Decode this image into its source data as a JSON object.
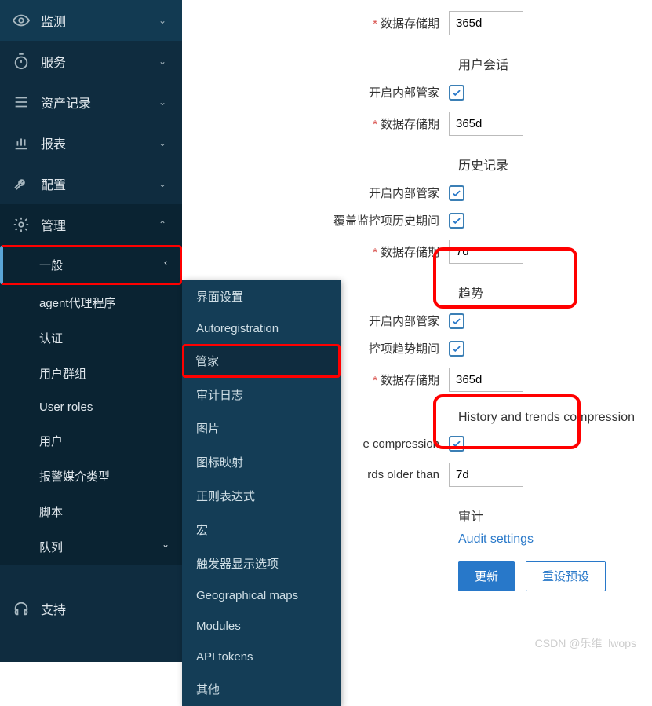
{
  "sidebar": {
    "main": [
      {
        "label": "监测",
        "icon": "eye"
      },
      {
        "label": "服务",
        "icon": "timer"
      },
      {
        "label": "资产记录",
        "icon": "list"
      },
      {
        "label": "报表",
        "icon": "chart"
      },
      {
        "label": "配置",
        "icon": "wrench"
      },
      {
        "label": "管理",
        "icon": "gear"
      }
    ],
    "sub": [
      {
        "label": "一般",
        "active": true
      },
      {
        "label": "agent代理程序"
      },
      {
        "label": "认证"
      },
      {
        "label": "用户群组"
      },
      {
        "label": "User roles"
      },
      {
        "label": "用户"
      },
      {
        "label": "报警媒介类型"
      },
      {
        "label": "脚本"
      },
      {
        "label": "队列"
      }
    ],
    "support": {
      "label": "支持",
      "icon": "headset"
    }
  },
  "submenu": [
    {
      "label": "界面设置"
    },
    {
      "label": "Autoregistration"
    },
    {
      "label": "管家",
      "active": true
    },
    {
      "label": "审计日志"
    },
    {
      "label": "图片"
    },
    {
      "label": "图标映射"
    },
    {
      "label": "正则表达式"
    },
    {
      "label": "宏"
    },
    {
      "label": "触发器显示选项"
    },
    {
      "label": "Geographical maps"
    },
    {
      "label": "Modules"
    },
    {
      "label": "API tokens"
    },
    {
      "label": "其他"
    }
  ],
  "form": {
    "top_storage": {
      "label": "数据存储期",
      "value": "365d"
    },
    "session": {
      "heading": "用户会话",
      "enable_label": "开启内部管家",
      "storage_label": "数据存储期",
      "storage_value": "365d"
    },
    "history": {
      "heading": "历史记录",
      "enable_label": "开启内部管家",
      "override_label": "覆盖监控项历史期间",
      "storage_label": "数据存储期",
      "storage_value": "7d"
    },
    "trends": {
      "heading": "趋势",
      "enable_label": "开启内部管家",
      "override_label": "控项趋势期间",
      "storage_label": "数据存储期",
      "storage_value": "365d"
    },
    "compression": {
      "heading": "History and trends compression",
      "enable_label": "e compression",
      "older_label": "rds older than",
      "older_value": "7d"
    },
    "audit": {
      "heading": "审计",
      "link": "Audit settings"
    },
    "buttons": {
      "update": "更新",
      "reset": "重设预设"
    }
  },
  "watermark": "CSDN @乐维_lwops"
}
